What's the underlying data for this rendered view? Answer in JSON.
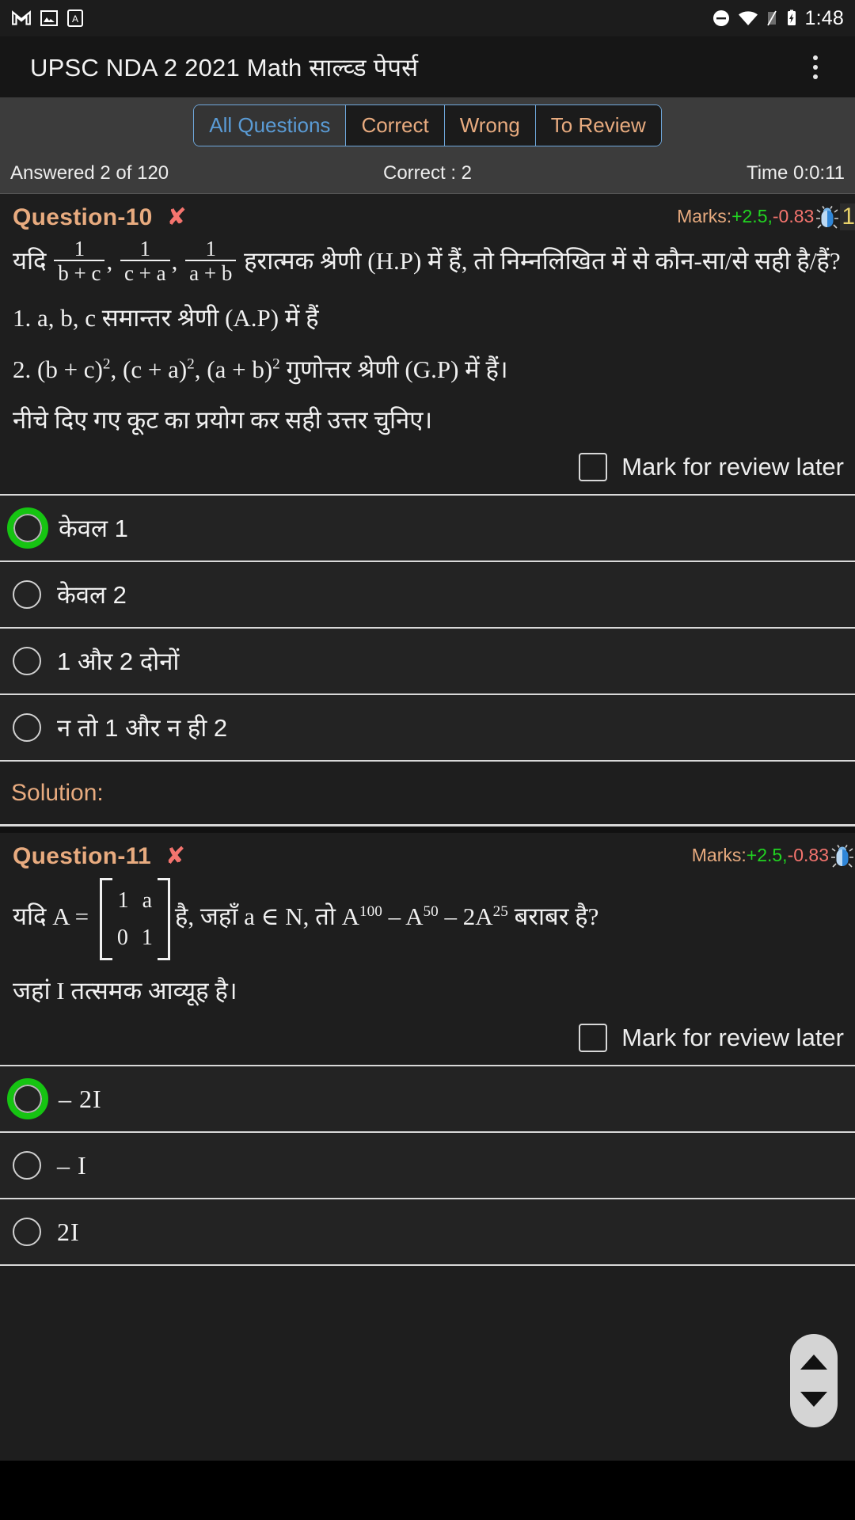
{
  "statusbar": {
    "icons": [
      "gmail-icon",
      "photos-icon",
      "app-icon"
    ],
    "right_icons": [
      "do-not-disturb-icon",
      "wifi-icon",
      "signal-icon",
      "battery-icon"
    ],
    "time": "1:48"
  },
  "appbar": {
    "title": "UPSC NDA 2 2021 Math साल्व्ड पेपर्स",
    "overflow_icon": "more-vertical-icon"
  },
  "filter_tabs": [
    {
      "label": "All Questions",
      "active": true
    },
    {
      "label": "Correct",
      "active": false
    },
    {
      "label": "Wrong",
      "active": false
    },
    {
      "label": "To Review",
      "active": false
    }
  ],
  "info": {
    "answered": "Answered 2 of 120",
    "correct": "Correct : 2",
    "time": "Time 0:0:11"
  },
  "questions": [
    {
      "title": "Question-10",
      "status_icon": "wrong-cross-icon",
      "marks_label": "Marks:",
      "marks_positive": "+2.5,",
      "marks_negative": "-0.83",
      "report_icon": "bug-icon",
      "badge": "1",
      "body": {
        "intro": "यदि",
        "fractions": [
          {
            "num": "1",
            "den": "b + c",
            "after": ","
          },
          {
            "num": "1",
            "den": "c + a",
            "after": ","
          },
          {
            "num": "1",
            "den": "a + b",
            "after": ""
          }
        ],
        "after_fractions": "हरात्मक श्रेणी (H.P) में हैं, तो निम्नलिखित में से कौन-सा/से सही है/हैं?",
        "statement1": "1. a, b, c समान्तर श्रेणी (A.P) में हैं",
        "statement2_pre": "2. (b + c)",
        "statement2_sup1": "2",
        "statement2_mid1": ", (c + a)",
        "statement2_sup2": "2",
        "statement2_mid2": ", (a + b)",
        "statement2_sup3": "2",
        "statement2_post": " गुणोत्तर श्रेणी (G.P) में हैं।",
        "statement3": "नीचे दिए गए कूट का प्रयोग कर सही उत्तर चुनिए।"
      },
      "mark_review_label": "Mark for review later",
      "mark_review_checked": false,
      "options": [
        {
          "label": "केवल 1",
          "state": "correct"
        },
        {
          "label": "केवल 2",
          "state": "normal"
        },
        {
          "label": "1 और 2 दोनों",
          "state": "normal"
        },
        {
          "label": "न तो 1 और न ही 2",
          "state": "normal"
        }
      ],
      "solution_label": "Solution:"
    },
    {
      "title": "Question-11",
      "status_icon": "wrong-cross-icon",
      "marks_label": "Marks:",
      "marks_positive": "+2.5,",
      "marks_negative": "-0.83",
      "report_icon": "bug-icon",
      "badge": "",
      "body": {
        "pre_matrix": "यदि A =",
        "matrix": [
          [
            "1",
            "a"
          ],
          [
            "0",
            "1"
          ]
        ],
        "post_matrix_1": "है, जहाँ a ∈ N, तो A",
        "sup1": "100",
        "mid1": " – A",
        "sup2": "50",
        "mid2": " – 2A",
        "sup3": "25",
        "post_matrix_2": " बराबर है?",
        "line2": "जहां I तत्समक आव्यूह है।"
      },
      "mark_review_label": "Mark for review later",
      "mark_review_checked": false,
      "options": [
        {
          "label": "– 2I",
          "state": "correct"
        },
        {
          "label": "– I",
          "state": "normal"
        },
        {
          "label": "2I",
          "state": "normal"
        }
      ]
    }
  ],
  "scroll_controls": {
    "up_icon": "chevron-up-icon",
    "down_icon": "chevron-down-icon"
  },
  "colors": {
    "accent_orange": "#e8ab7f",
    "accent_blue": "#5a9bd5",
    "correct_green": "#16c412",
    "wrong_red": "#f4746e",
    "badge_yellow": "#e8d26a",
    "background": "#1e1e1e"
  }
}
